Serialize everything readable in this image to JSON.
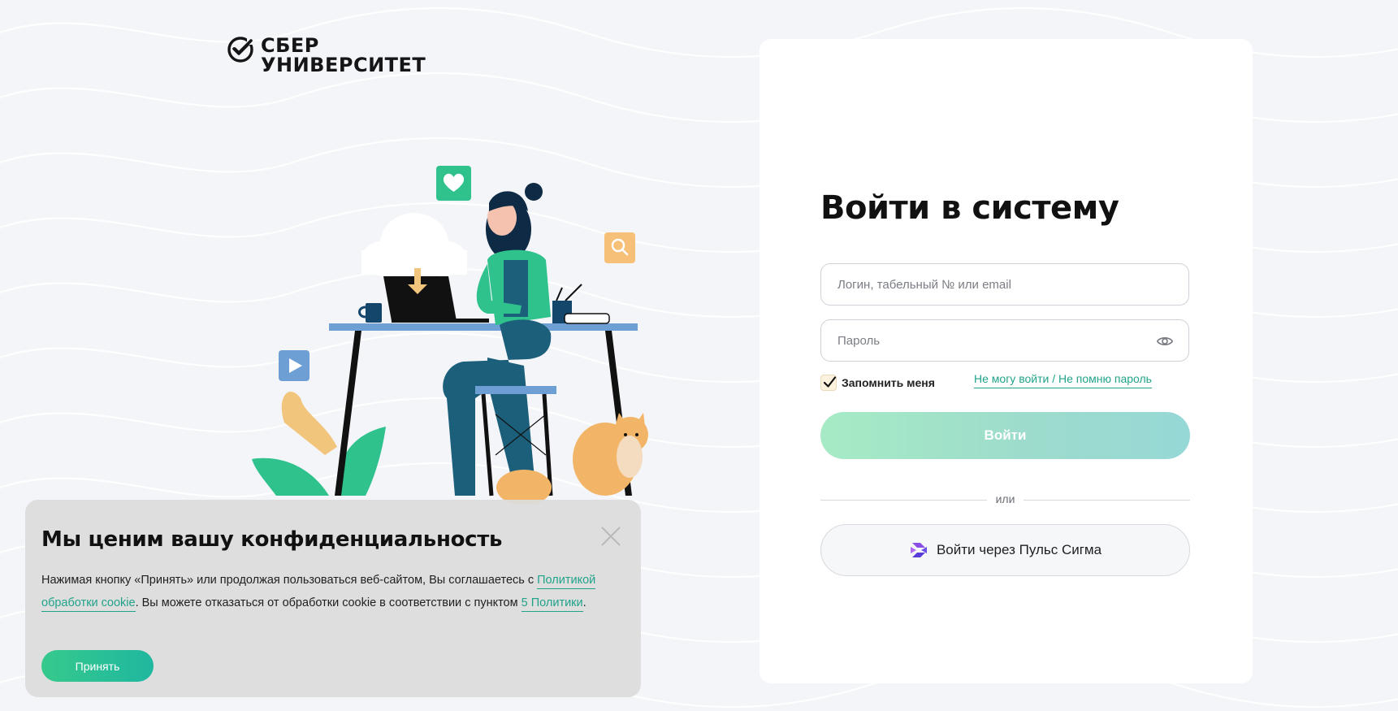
{
  "brand": {
    "name_line1": "СБЕР",
    "name_line2": "УНИВЕРСИТЕТ",
    "logo_icon": "sber-check-icon",
    "accent_color": "#21a38a"
  },
  "login": {
    "title": "Войти в систему",
    "login_field": {
      "placeholder": "Логин, табельный № или email",
      "value": ""
    },
    "password_field": {
      "placeholder": "Пароль",
      "value": ""
    },
    "remember_label": "Запомнить меня",
    "remember_checked": true,
    "forgot_link": "Не могу войти / Не помню пароль",
    "submit_label": "Войти",
    "or_label": "или",
    "sigma_label": "Войти через Пульс Сигма"
  },
  "cookie_banner": {
    "title": "Мы ценим вашу конфиденциальность",
    "text_1": "Нажимая кнопку «Принять» или продолжая пользоваться веб-сайтом, Вы соглашаетесь с ",
    "policy_link": "Политикой обработки cookie",
    "text_2": ". Вы можете отказаться от обработки cookie в соответствии с пунктом ",
    "point_link": "5 Политики",
    "text_3": ".",
    "accept_label": "Принять"
  },
  "icons": {
    "eye": "eye-icon",
    "close": "close-icon",
    "checkmark": "checkmark-icon",
    "sigma": "sigma-logo-icon"
  }
}
